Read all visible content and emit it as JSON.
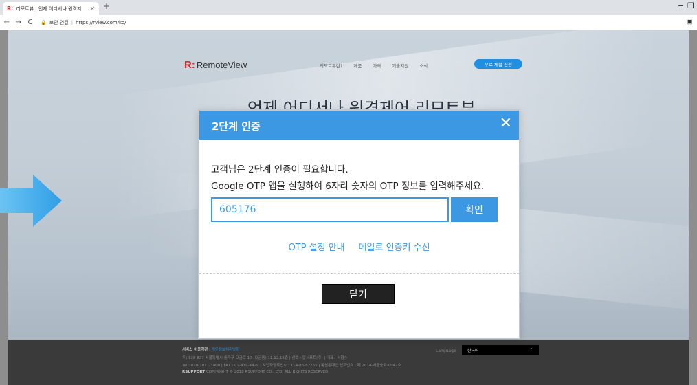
{
  "browser": {
    "tab_favicon": "R:",
    "tab_title": "리모트뷰 | 언제 어디서나 원격지",
    "tab_close": "×",
    "new_tab": "+",
    "minimize": "−",
    "restore": "❐",
    "back": "←",
    "forward": "→",
    "reload": "C",
    "lock": "🔒",
    "security_text": "보안 연결",
    "url": "https://rview.com/ko/",
    "profile_icon": "▣"
  },
  "site": {
    "logo_mark": "R:",
    "logo_text": "RemoteView",
    "nav": [
      "리모트뷰란?",
      "제품",
      "가격",
      "기술지원",
      "소식"
    ],
    "trial_button": "무료 체험 신청",
    "headline": "언제 어디서나 원격제어 리모트뷰"
  },
  "modal": {
    "title": "2단계 인증",
    "close_icon": "✕",
    "message_line1": "고객님은 2단계 인증이 필요합니다.",
    "message_line2": "Google OTP 앱을 실행하여 6자리 숫자의 OTP 정보를 입력해주세요.",
    "otp_value": "605176",
    "confirm_label": "확인",
    "link_otp_guide": "OTP 설정 안내",
    "link_email_key": "메일로 인증키 수신",
    "close_label": "닫기"
  },
  "carousel": {
    "active_index": 0,
    "count": 3
  },
  "footer": {
    "terms": "서비스 이용약관",
    "privacy": "개인정보처리방침",
    "address": "우) 138-827 서울특별시 송파구 오금로 10 (오금동) 11,12,15층 | 상호 : 알서포트(주) | 대표 : 서형수",
    "contact": "Tel : 070-7011-3900 | FAX : 02-479-4429 | 사업자등록번호 : 114-86-82265 | 통신판매업 신고번호 : 제 2014-서울송파-0047호",
    "brand": "RSUPPORT",
    "copyright": "COPYRIGHT © 2018 RSUPPORT CO., LTD. ALL RIGHTS RESERVED.",
    "language_label": "Language",
    "language_value": "한국어",
    "language_arrow": "⌃"
  },
  "colors": {
    "accent": "#3d98e3",
    "arrow": "#3aa7e8",
    "brand_red": "#d42b2b"
  }
}
